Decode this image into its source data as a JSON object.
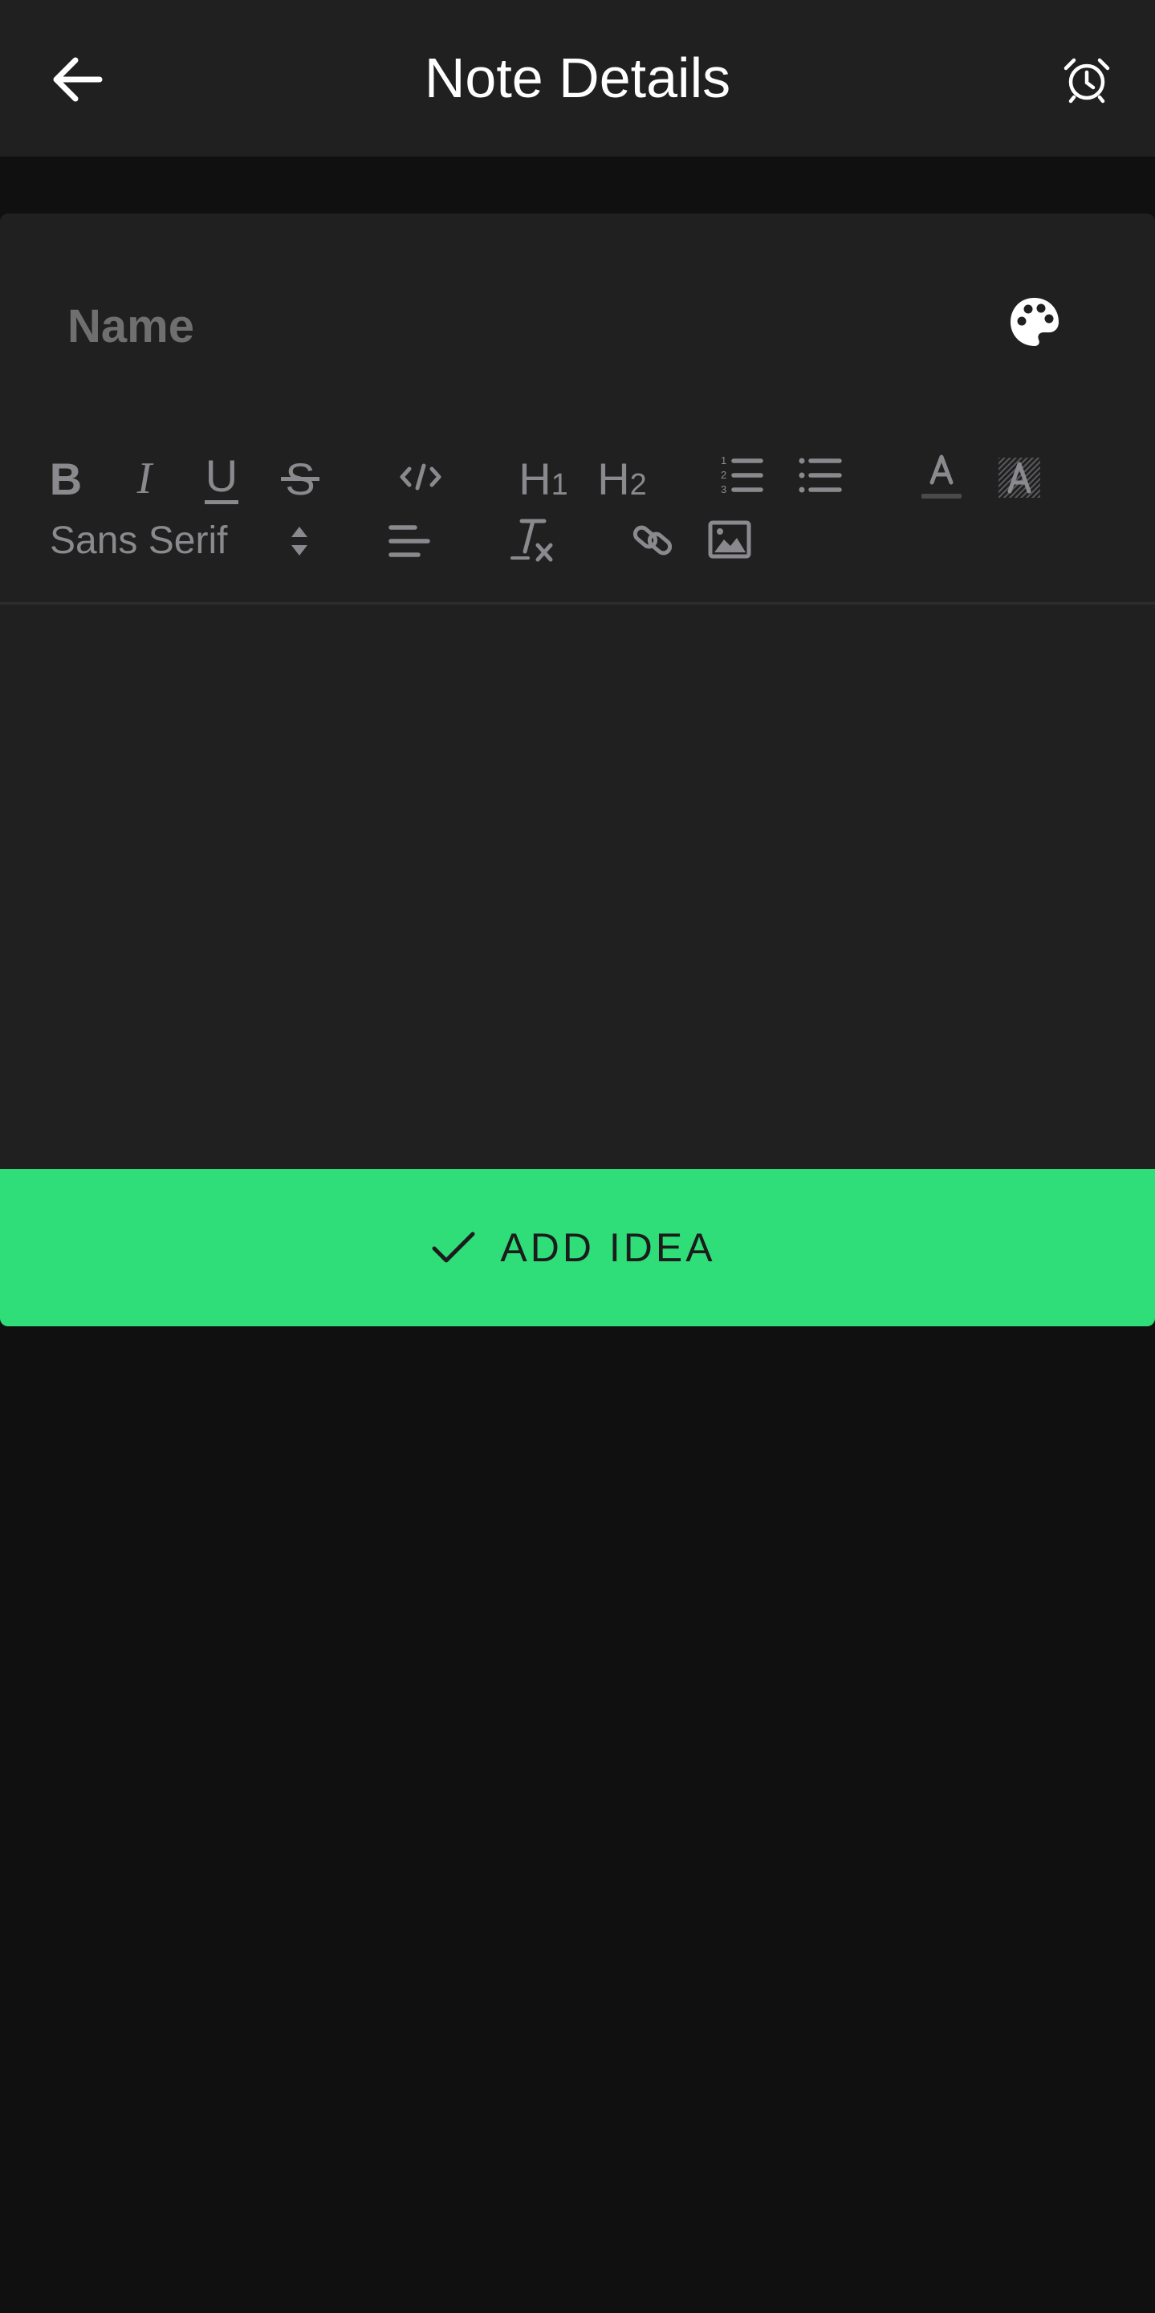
{
  "appbar": {
    "title": "Note Details",
    "back_icon": "arrow-left-icon",
    "alarm_icon": "alarm-clock-icon"
  },
  "form": {
    "name_placeholder": "Name",
    "name_value": "",
    "palette_icon": "palette-icon"
  },
  "toolbar": {
    "bold": "B",
    "italic": "I",
    "underline": "U",
    "strike": "S",
    "h1": "H",
    "h1_sub": "1",
    "h2": "H",
    "h2_sub": "2",
    "font": "Sans Serif",
    "icons": [
      "code-icon",
      "ordered-list-icon",
      "bullet-list-icon",
      "text-color-icon",
      "background-color-icon",
      "align-left-icon",
      "clear-format-icon",
      "link-icon",
      "image-icon"
    ]
  },
  "editor": {
    "content": ""
  },
  "add_button": {
    "label": "ADD IDEA",
    "icon": "check-icon"
  },
  "colors": {
    "background": "#111011",
    "surface": "#202020",
    "accent": "#2fde78",
    "toolbar_icon": "#8a8a8e"
  }
}
